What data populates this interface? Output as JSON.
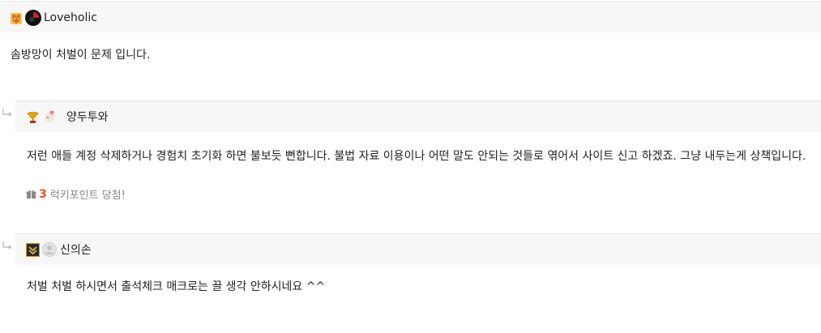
{
  "comment": {
    "author": "Loveholic",
    "text": "솜방망이 처벌이 문제 입니다."
  },
  "replies": [
    {
      "author": "양두투와",
      "text": "저런 애들 계정 삭제하거나 경험치 초기화 하면 불보듯 뻔합니다. 불법 자료 이용이나 어떤 말도 안되는 것들로 엮어서 사이트 신고 하겠죠. 그냥 내두는게 상책입니다.",
      "lucky_count": "3",
      "lucky_label": "럭키포인트 당첨!"
    },
    {
      "author": "신의손",
      "text": "처벌 처벌 하시면서 출석체크 매크로는 끌 생각 안하시네요 ^^"
    }
  ],
  "icons": {
    "level_badge_top": "fox-badge-icon",
    "avatar_top": "avatar-icon",
    "level_badge_reply1": "trophy-icon",
    "avatar_reply1": "cartoon-avatar-icon",
    "level_badge_reply2": "rank-chevron-icon",
    "avatar_reply2": "default-avatar-icon",
    "reply_arrow": "reply-arrow-icon",
    "gift": "gift-icon"
  },
  "colors": {
    "header_bg": "#f7f7f8",
    "lucky_count": "#e8551f"
  }
}
